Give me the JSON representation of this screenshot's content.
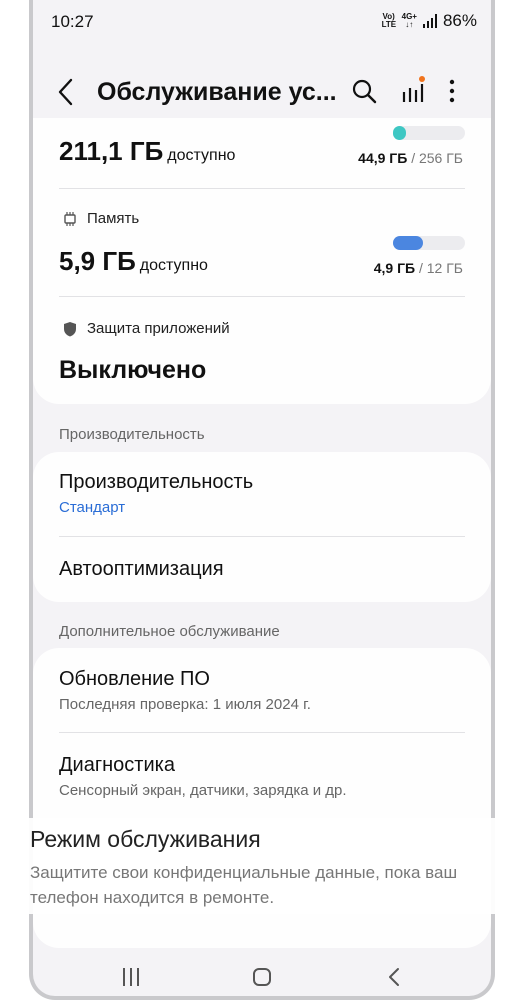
{
  "status_bar": {
    "time": "10:27",
    "volte_label": "Vo) LTE",
    "network_label": "4G+",
    "battery": "86%"
  },
  "app_bar": {
    "title": "Обслуживание ус...",
    "icons": [
      "back-icon",
      "search-icon",
      "stats-icon",
      "more-icon"
    ],
    "badge_color": "#f0731d"
  },
  "storage": {
    "amount": "211,1 ГБ",
    "available_label": "доступно",
    "used": "44,9 ГБ",
    "separator": "/",
    "total": "256 ГБ",
    "usage_fraction": 0.18,
    "bar_color": "#3ec7c3"
  },
  "memory": {
    "label": "Память",
    "amount": "5,9 ГБ",
    "available_label": "доступно",
    "used": "4,9 ГБ",
    "separator": "/",
    "total": "12 ГБ",
    "usage_fraction": 0.41,
    "bar_color": "#4b86e0"
  },
  "app_protection": {
    "label": "Защита приложений",
    "value": "Выключено"
  },
  "performance_section": {
    "header": "Производительность",
    "items": [
      {
        "title": "Производительность",
        "subtitle": "Стандарт"
      },
      {
        "title": "Автооптимизация"
      }
    ]
  },
  "extra_section": {
    "header": "Дополнительное обслуживание",
    "items": [
      {
        "title": "Обновление ПО",
        "subtitle": "Последняя проверка: 1 июля 2024 г."
      },
      {
        "title": "Диагностика",
        "subtitle": "Сенсорный экран, датчики, зарядка и др."
      }
    ]
  },
  "caption": {
    "title": "Режим обслуживания",
    "text": "Защитите свои конфиденциальные данные, пока ваш телефон находится в ремонте."
  },
  "nav_bar": {
    "icons": [
      "recent-apps-icon",
      "home-icon",
      "nav-back-icon"
    ]
  }
}
